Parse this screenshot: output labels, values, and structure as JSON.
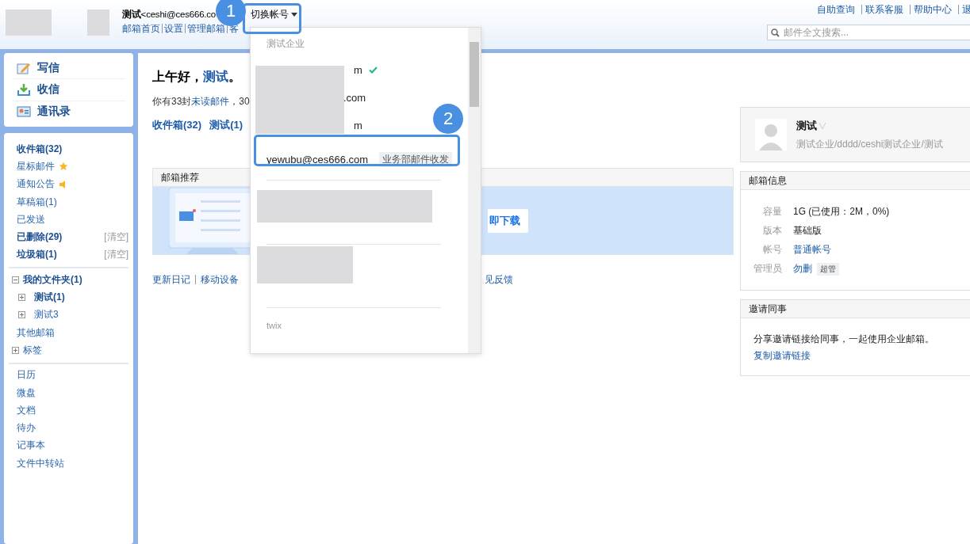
{
  "header": {
    "user_name": "测试",
    "user_email": "<ceshi@ces666.co",
    "nav_links": [
      "邮箱首页",
      "设置",
      "管理邮箱",
      "客"
    ],
    "switch_account": {
      "label": "切换帐号",
      "expanded": true
    },
    "top_links": [
      "自助查询",
      "联系客服",
      "帮助中心",
      "退"
    ],
    "search": {
      "placeholder": "邮件全文搜索..."
    }
  },
  "actions": [
    {
      "label": "写信",
      "kind": "compose"
    },
    {
      "label": "收信",
      "kind": "receive"
    },
    {
      "label": "通讯录",
      "kind": "contacts"
    }
  ],
  "folder_sections": [
    {
      "items": [
        {
          "label": "收件箱(32)",
          "bold": true
        },
        {
          "label": "星标邮件",
          "bold": false,
          "kind": "starred"
        },
        {
          "label": "通知公告",
          "bold": false,
          "kind": "notice"
        },
        {
          "label": "草稿箱(1)",
          "bold": false
        },
        {
          "label": "已发送",
          "bold": false
        },
        {
          "label": "已删除(29)",
          "bold": true,
          "action": "[清空]"
        },
        {
          "label": "垃圾箱(1)",
          "bold": true,
          "action": "[清空]"
        }
      ]
    },
    {
      "items": [
        {
          "label": "我的文件夹(1)",
          "bold": true,
          "expanded": true,
          "children": [
            {
              "label": "测试(1)",
              "bold": true,
              "expanded": false
            },
            {
              "label": "测试3",
              "bold": false,
              "expanded": false
            }
          ]
        },
        {
          "label": "其他邮箱",
          "bold": false
        },
        {
          "label": "标签",
          "bold": false,
          "expanded": false
        }
      ]
    },
    {
      "items": [
        {
          "label": "日历",
          "bold": false
        },
        {
          "label": "微盘",
          "bold": false
        },
        {
          "label": "文档",
          "bold": false
        },
        {
          "label": "待办",
          "bold": false
        },
        {
          "label": "记事本",
          "bold": false
        },
        {
          "label": "文件中转站",
          "bold": false
        }
      ]
    }
  ],
  "main": {
    "greeting": {
      "prefix": "上午好，",
      "name": "测试",
      "suffix": "。"
    },
    "unread": {
      "prefix": "你有33封",
      "link": "未读邮件",
      "suffix": "，30"
    },
    "quick_links": [
      "收件箱(32)",
      "测试(1)"
    ],
    "recommend": {
      "title": "邮箱推荐",
      "button": "即下载"
    },
    "footer_links": [
      "更新日记",
      "移动设备",
      "见反馈"
    ]
  },
  "profile": {
    "name": "测试",
    "path": "测试企业/dddd/ceshi测试企业/测试"
  },
  "mailbox_info": {
    "title": "邮箱信息",
    "rows": [
      {
        "label": "容量",
        "value": "1G (已使用：2M，0%)",
        "kind": "text"
      },
      {
        "label": "版本",
        "value": "基础版",
        "kind": "text"
      },
      {
        "label": "帐号",
        "value": "普通帐号",
        "kind": "link"
      },
      {
        "label": "管理员",
        "value": "勿删",
        "kind": "link",
        "tag": "超管"
      }
    ]
  },
  "invite": {
    "title": "邀请同事",
    "text": "分享邀请链接给同事，一起使用企业邮箱。",
    "link": "复制邀请链接"
  },
  "account_menu": {
    "group_label": "测试企业",
    "accounts": [
      {
        "text": "m",
        "selected": true
      },
      {
        "text": ".com",
        "selected": false
      },
      {
        "text": "m",
        "selected": false
      },
      {
        "text": "yewubu@ces666.com",
        "tag": "业务部邮件收发",
        "selected": false
      }
    ],
    "second_group_label": "twix"
  },
  "annotations": [
    {
      "number": "1"
    },
    {
      "number": "2"
    }
  ]
}
